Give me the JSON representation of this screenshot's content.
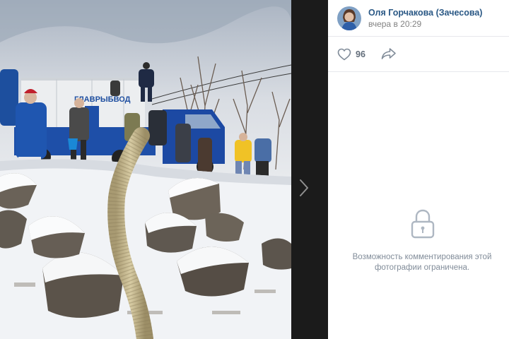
{
  "photo": {
    "truck_sign": "ГЛАВРЫБВОД"
  },
  "author": {
    "name": "Оля Горчакова (Зачесова)",
    "time": "вчера в 20:29",
    "avatar_icon": "avatar-photo"
  },
  "actions": {
    "likes": "96",
    "like_icon": "heart-icon",
    "share_icon": "share-arrow-icon"
  },
  "comments": {
    "lock_icon": "lock-icon",
    "message": "Возможность комментирования этой фотографии ограничена."
  },
  "colors": {
    "nav_strip": "#1b1b1b",
    "link": "#2a5885",
    "muted": "#828282",
    "divider": "#e7e8ec"
  }
}
